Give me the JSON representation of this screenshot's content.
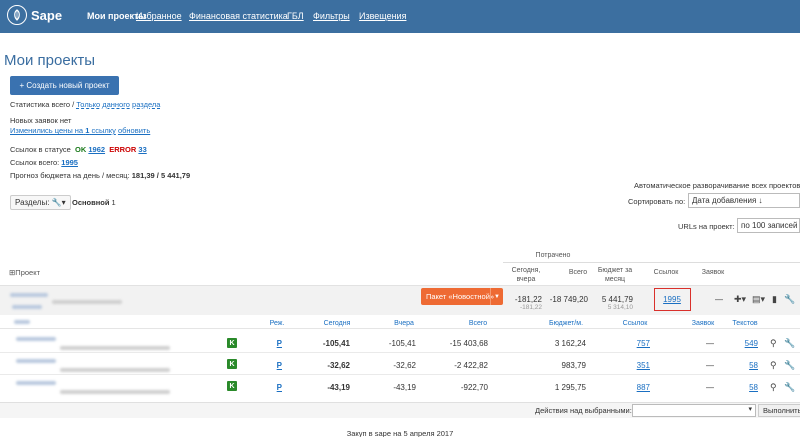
{
  "nav": {
    "logo": "Sape",
    "items": [
      "Мои проекты",
      "Избранное",
      "Финансовая статистика",
      "ГБЛ",
      "Фильтры",
      "Извещения"
    ]
  },
  "page": {
    "title": "Мои проекты",
    "create_button": "+ Создать новый проект",
    "stats_prefix": "Статистика всего /",
    "stats_link": "Только данного раздела",
    "no_new_requests": "Новых заявок нет",
    "price_changed": "Изменились цены на",
    "price_count": "1",
    "price_suffix": "ссылку",
    "price_update": "обновить",
    "links_status_label": "Ссылок в статусе",
    "ok_label": "OK",
    "ok_count": "1962",
    "error_label": "ERROR",
    "error_count": "33",
    "links_total_label": "Ссылок всего:",
    "links_total": "1995",
    "budget_label": "Прогноз бюджета на день / месяц:",
    "budget_value": "181,39 / 5 441,79",
    "auto_unfold": "Автоматическое разворачивание всех проектов",
    "sort_label": "Сортировать по:",
    "sort_value": "Дата добавления ↓",
    "urls_label": "URLs на проект:",
    "urls_value": "по 100 записей",
    "sections_button": "Разделы:",
    "section_name": "Основной",
    "section_count": "1"
  },
  "table_header": {
    "project": "Проект",
    "spent": "Потрачено",
    "today_yesterday": "Сегодня, вчера",
    "total": "Всего",
    "budget_month": "Бюджет за месяц",
    "links": "Ссылок",
    "requests": "Заявок"
  },
  "project": {
    "package_button": "Пакет «Новостной»",
    "today": "-181,22",
    "yesterday": "-181,22",
    "total": "-18 749,20",
    "budget": "5 441,79",
    "budget_sub": "5 314,10",
    "links": "1995",
    "requests": "—"
  },
  "sub_header": {
    "mode": "Реж.",
    "today": "Сегодня",
    "yesterday": "Вчера",
    "total": "Всего",
    "budget": "Бюджет/м.",
    "links": "Ссылок",
    "requests": "Заявок",
    "texts": "Текстов"
  },
  "rows": [
    {
      "badge": "K",
      "mode": "P",
      "today": "-105,41",
      "yesterday": "-105,41",
      "total": "-15 403,68",
      "budget": "3 162,24",
      "links": "757",
      "requests": "—",
      "texts": "549"
    },
    {
      "badge": "K",
      "mode": "P",
      "today": "-32,62",
      "yesterday": "-32,62",
      "total": "-2 422,82",
      "budget": "983,79",
      "links": "351",
      "requests": "—",
      "texts": "58"
    },
    {
      "badge": "K",
      "mode": "P",
      "today": "-43,19",
      "yesterday": "-43,19",
      "total": "-922,70",
      "budget": "1 295,75",
      "links": "887",
      "requests": "—",
      "texts": "58"
    }
  ],
  "bottom": {
    "actions_label": "Действия над выбранными:",
    "exec_button": "Выполнить"
  },
  "footer": "Закуп в sape на 5 апреля 2017"
}
